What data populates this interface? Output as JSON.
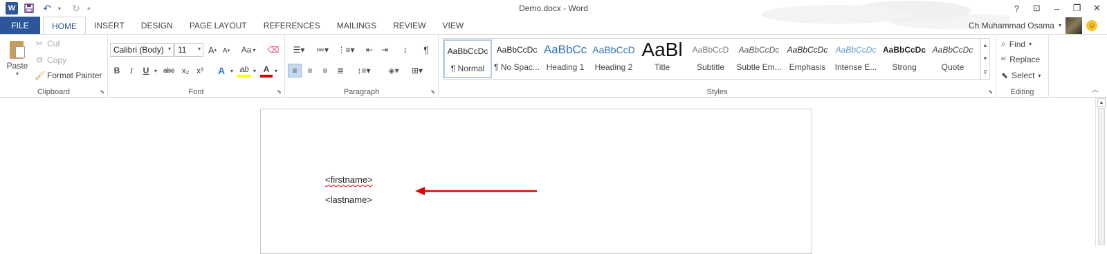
{
  "title_bar": {
    "app_logo": "W",
    "document_title": "Demo.docx - Word",
    "window_controls": [
      "?",
      "⊡",
      "–",
      "❐",
      "✕"
    ]
  },
  "ribbon_tabs": {
    "file": "FILE",
    "tabs": [
      "HOME",
      "INSERT",
      "DESIGN",
      "PAGE LAYOUT",
      "REFERENCES",
      "MAILINGS",
      "REVIEW",
      "VIEW"
    ],
    "active_tab": "HOME"
  },
  "user": {
    "name": "Ch Muhammad Osama"
  },
  "clipboard": {
    "paste": "Paste",
    "cut": "Cut",
    "copy": "Copy",
    "format_painter": "Format Painter",
    "label": "Clipboard"
  },
  "font": {
    "family": "Calibri (Body)",
    "size": "11",
    "label": "Font",
    "grow": "A",
    "shrink": "A",
    "change_case": "Aa",
    "bold": "B",
    "italic": "I",
    "underline": "U",
    "strikethrough": "abc",
    "subscript": "x₂",
    "superscript": "x²",
    "text_effects": "A",
    "highlight": "ab",
    "font_color": "A"
  },
  "paragraph": {
    "label": "Paragraph",
    "show_marks": "¶"
  },
  "styles": {
    "label": "Styles",
    "items": [
      {
        "sample": "AaBbCcDc",
        "name": "¶ Normal"
      },
      {
        "sample": "AaBbCcDc",
        "name": "¶ No Spac..."
      },
      {
        "sample": "AaBbCc",
        "name": "Heading 1"
      },
      {
        "sample": "AaBbCcD",
        "name": "Heading 2"
      },
      {
        "sample": "AaBl",
        "name": "Title"
      },
      {
        "sample": "AaBbCcD",
        "name": "Subtitle"
      },
      {
        "sample": "AaBbCcDc",
        "name": "Subtle Em..."
      },
      {
        "sample": "AaBbCcDc",
        "name": "Emphasis"
      },
      {
        "sample": "AaBbCcDc",
        "name": "Intense E..."
      },
      {
        "sample": "AaBbCcDc",
        "name": "Strong"
      },
      {
        "sample": "AaBbCcDc",
        "name": "Quote"
      }
    ]
  },
  "editing": {
    "find": "Find",
    "replace": "Replace",
    "select": "Select",
    "label": "Editing"
  },
  "document": {
    "lines": [
      "<firstname>",
      "<lastname>"
    ]
  },
  "colors": {
    "accent": "#2b579a",
    "annotation_arrow": "#e00000",
    "spelling_squiggle": "#e00000"
  }
}
